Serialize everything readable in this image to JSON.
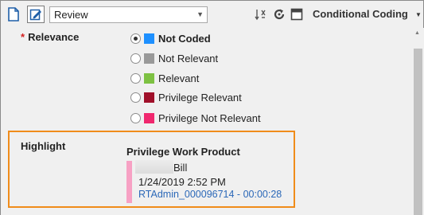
{
  "toolbar": {
    "layout_select_value": "Review",
    "mode_label": "Conditional Coding",
    "icons": [
      "document-icon",
      "edit-document-icon",
      "sort-icon",
      "refresh-icon",
      "panel-icon",
      "chevron-down-icon"
    ]
  },
  "relevance": {
    "label": "Relevance",
    "required_marker": "*",
    "options": [
      {
        "label": "Not Coded",
        "color": "#1e90ff",
        "checked": true
      },
      {
        "label": "Not Relevant",
        "color": "#999999",
        "checked": false
      },
      {
        "label": "Relevant",
        "color": "#7dc142",
        "checked": false
      },
      {
        "label": "Privilege Relevant",
        "color": "#a0102a",
        "checked": false
      },
      {
        "label": "Privilege Not Relevant",
        "color": "#f0286e",
        "checked": false
      }
    ]
  },
  "highlight": {
    "label": "Highlight",
    "title": "Privilege Work Product",
    "user": "Bill",
    "date": "1/24/2019 2:52 PM",
    "link": "RTAdmin_000096714 - 00:00:28",
    "bar_color": "#f7a1c4"
  },
  "colors": {
    "accent_border": "#f08c1a",
    "link": "#2b68b8"
  }
}
